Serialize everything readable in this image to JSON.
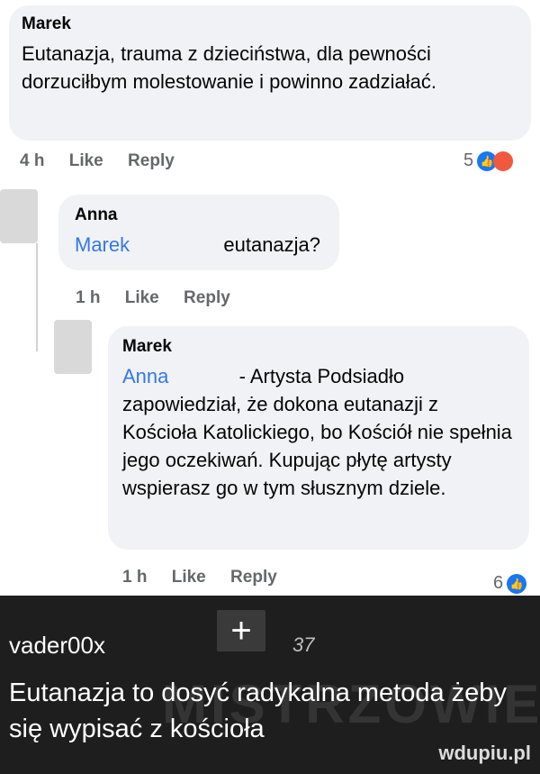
{
  "comments": [
    {
      "author": "Marek",
      "text": "Eutanazja, trauma z dzieciństwa, dla pewności dorzuciłbym molestowanie i powinno zadziałać.",
      "time": "4 h",
      "like": "Like",
      "reply": "Reply",
      "reaction_count": "5"
    },
    {
      "author": "Anna",
      "tag": "Marek",
      "text": "eutanazja?",
      "time": "1 h",
      "like": "Like",
      "reply": "Reply"
    },
    {
      "author": "Marek",
      "tag": "Anna",
      "text_first": "- Artysta Podsiadło",
      "text_rest": "zapowiedział, że dokona eutanazji z Kościoła Katolickiego, bo Kościół nie spełnia jego oczekiwań. Kupując płytę artysty wspierasz go w tym słusznym dziele.",
      "time": "1 h",
      "like": "Like",
      "reply": "Reply",
      "reaction_count": "6"
    }
  ],
  "post": {
    "username": "vader00x",
    "score": "37",
    "plus_label": "+",
    "text": "Eutanazja to dosyć radykalna metoda żeby się wypisać z kościoła"
  },
  "watermark": "MISTRZOWIE",
  "brand": "wdupiu.pl",
  "colors": {
    "bubble": "#f0f2f5",
    "tag": "#3578e5",
    "dark_bg": "#1e1e1e",
    "like": "#1877f2",
    "angry": "#f0593e"
  }
}
